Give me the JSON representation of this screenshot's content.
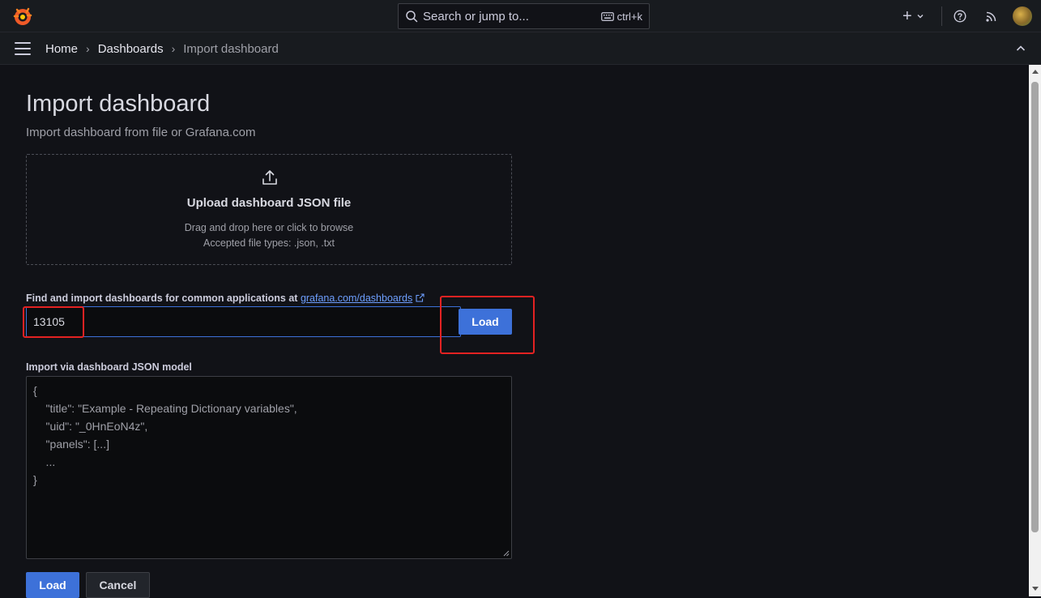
{
  "search": {
    "placeholder": "Search or jump to...",
    "shortcut": "ctrl+k"
  },
  "topbar": {
    "new_symbol": "+"
  },
  "breadcrumb": {
    "home": "Home",
    "dashboards": "Dashboards",
    "current": "Import dashboard",
    "separator": "›"
  },
  "page": {
    "title": "Import dashboard",
    "subtitle": "Import dashboard from file or Grafana.com"
  },
  "upload": {
    "title": "Upload dashboard JSON file",
    "hint": "Drag and drop here or click to browse",
    "accepted": "Accepted file types: .json, .txt"
  },
  "grafana_com": {
    "label": "Find and import dashboards for common applications at",
    "link_text": "grafana.com/dashboards",
    "input_value": "13105",
    "load_label": "Load"
  },
  "json_model": {
    "label": "Import via dashboard JSON model",
    "lines": [
      "{",
      "    \"title\": \"Example - Repeating Dictionary variables\",",
      "    \"uid\": \"_0HnEoN4z\",",
      "    \"panels\": [...]",
      "    ...",
      "}"
    ]
  },
  "actions": {
    "load_label": "Load",
    "cancel_label": "Cancel"
  },
  "colors": {
    "accent": "#3d71d9",
    "link": "#6e9fff",
    "highlight": "#e32222",
    "logo": "#f05a28"
  }
}
